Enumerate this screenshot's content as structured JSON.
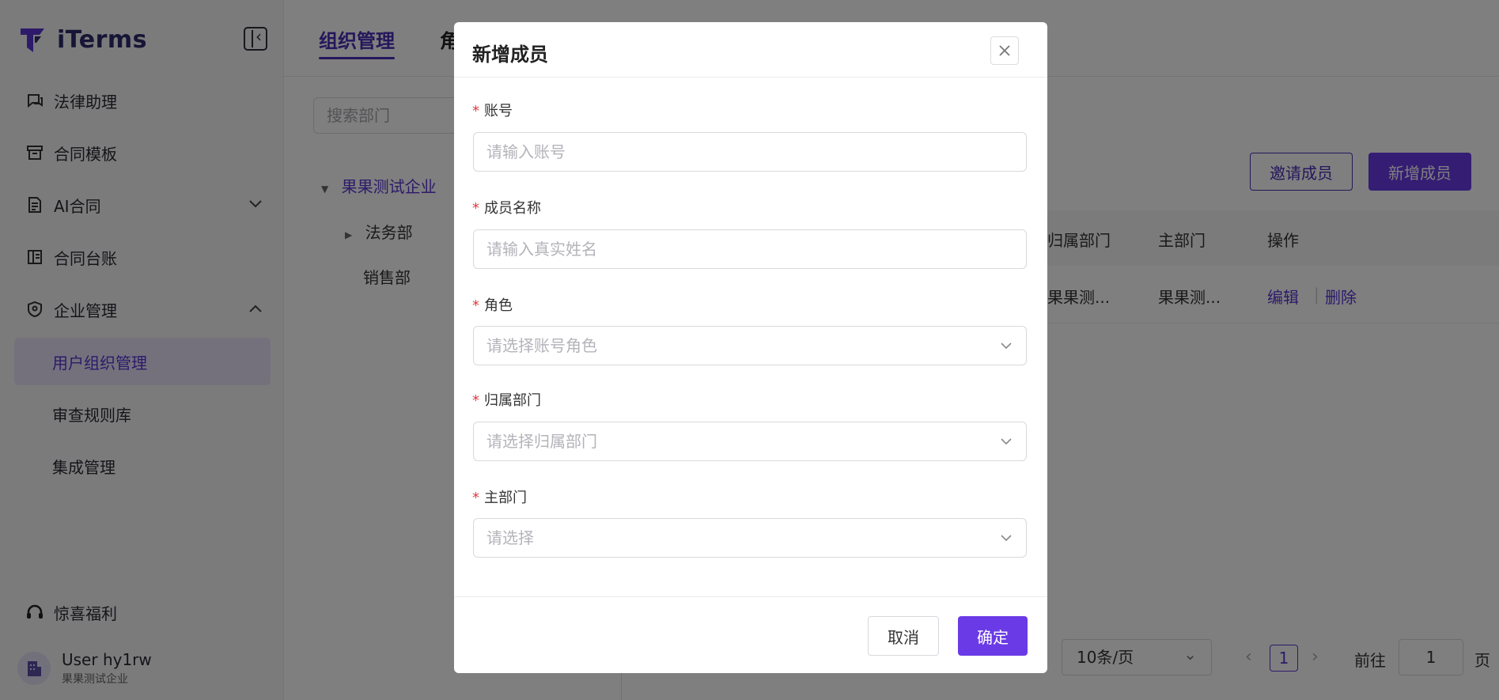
{
  "app": {
    "logo_text": "iTerms"
  },
  "sidebar": {
    "items": [
      {
        "label": "法律助理",
        "icon": "chat-icon"
      },
      {
        "label": "合同模板",
        "icon": "archive-icon"
      },
      {
        "label": "AI合同",
        "icon": "document-icon",
        "expand": "collapsed"
      },
      {
        "label": "合同台账",
        "icon": "ledger-icon"
      },
      {
        "label": "企业管理",
        "icon": "shield-icon",
        "expand": "expanded"
      }
    ],
    "sub_items": [
      {
        "label": "用户组织管理",
        "active": true
      },
      {
        "label": "审查规则库"
      },
      {
        "label": "集成管理"
      }
    ],
    "bottom_item": {
      "label": "惊喜福利",
      "icon": "headset-icon"
    },
    "user": {
      "name": "User hy1rw",
      "org": "果果测试企业"
    }
  },
  "main": {
    "tabs": [
      {
        "label": "组织管理",
        "active": true
      },
      {
        "label": "角"
      }
    ],
    "dept_search_placeholder": "搜索部门",
    "tree": {
      "root": "果果测试企业",
      "children": [
        "法务部",
        "销售部"
      ]
    },
    "invite_button": "邀请成员",
    "add_button": "新增成员",
    "table": {
      "headers": [
        "归属部门",
        "主部门",
        "操作"
      ],
      "rows": [
        {
          "dept": "果果测...",
          "main_dept": "果果测...",
          "edit": "编辑",
          "delete": "删除"
        }
      ]
    },
    "pagination": {
      "page_size": "10条/页",
      "current_page": "1",
      "goto_label": "前往",
      "goto_value": "1",
      "page_suffix": "页"
    }
  },
  "modal": {
    "title": "新增成员",
    "fields": [
      {
        "label": "账号",
        "placeholder": "请输入账号",
        "type": "text"
      },
      {
        "label": "成员名称",
        "placeholder": "请输入真实姓名",
        "type": "text"
      },
      {
        "label": "角色",
        "placeholder": "请选择账号角色",
        "type": "select"
      },
      {
        "label": "归属部门",
        "placeholder": "请选择归属部门",
        "type": "select"
      },
      {
        "label": "主部门",
        "placeholder": "请选择",
        "type": "select"
      }
    ],
    "required_mark": "*",
    "cancel": "取消",
    "confirm": "确定"
  },
  "colors": {
    "accent": "#6a3ae6",
    "accent_dark": "#4a2fb8",
    "required": "#e0393e",
    "overlay": "rgba(0,0,0,0.5)"
  }
}
